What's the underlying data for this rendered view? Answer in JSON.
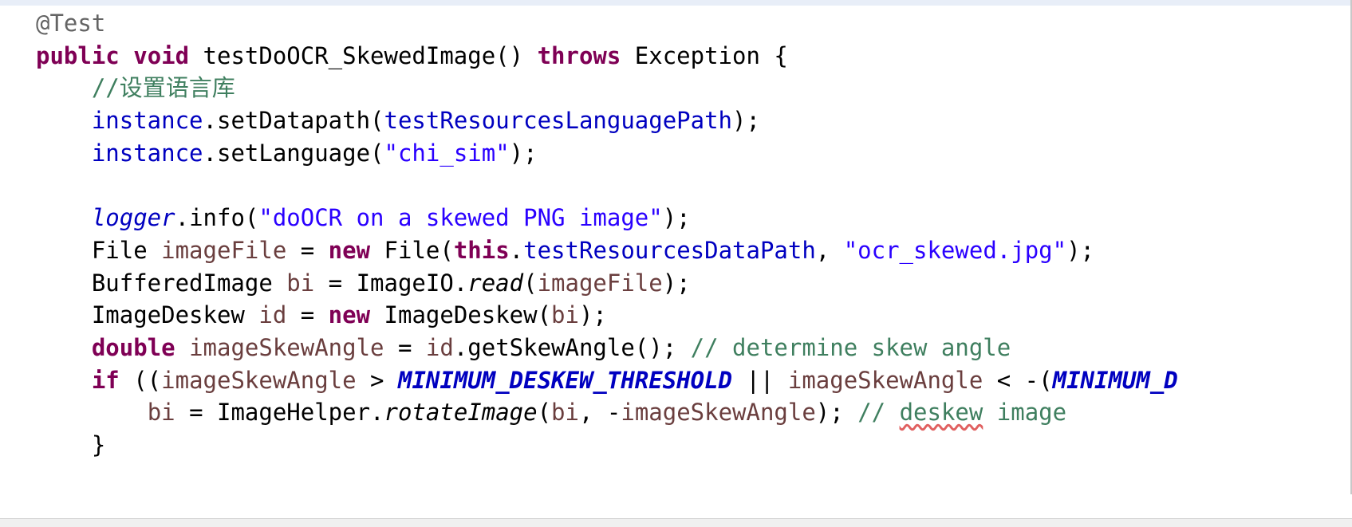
{
  "editor": {
    "lines": [
      {
        "tokens": [
          {
            "t": "@Test",
            "c": "annotation"
          }
        ]
      },
      {
        "tokens": [
          {
            "t": "public",
            "c": "kw"
          },
          {
            "t": " "
          },
          {
            "t": "void",
            "c": "kw"
          },
          {
            "t": " testDoOCR_SkewedImage() "
          },
          {
            "t": "throws",
            "c": "kw"
          },
          {
            "t": " Exception {"
          }
        ]
      },
      {
        "tokens": [
          {
            "t": "    "
          },
          {
            "t": "//设置语言库",
            "c": "cmt"
          }
        ]
      },
      {
        "tokens": [
          {
            "t": "    "
          },
          {
            "t": "instance",
            "c": "field"
          },
          {
            "t": ".setDatapath("
          },
          {
            "t": "testResourcesLanguagePath",
            "c": "field"
          },
          {
            "t": ");"
          }
        ]
      },
      {
        "tokens": [
          {
            "t": "    "
          },
          {
            "t": "instance",
            "c": "field"
          },
          {
            "t": ".setLanguage("
          },
          {
            "t": "\"chi_sim\"",
            "c": "str"
          },
          {
            "t": ");"
          }
        ]
      },
      {
        "tokens": []
      },
      {
        "tokens": [
          {
            "t": "    "
          },
          {
            "t": "logger",
            "c": "static-i"
          },
          {
            "t": ".info("
          },
          {
            "t": "\"doOCR on a skewed PNG image\"",
            "c": "str"
          },
          {
            "t": ");"
          }
        ]
      },
      {
        "tokens": [
          {
            "t": "    File "
          },
          {
            "t": "imageFile",
            "c": "local"
          },
          {
            "t": " = "
          },
          {
            "t": "new",
            "c": "kw"
          },
          {
            "t": " File("
          },
          {
            "t": "this",
            "c": "kw"
          },
          {
            "t": "."
          },
          {
            "t": "testResourcesDataPath",
            "c": "field"
          },
          {
            "t": ", "
          },
          {
            "t": "\"ocr_skewed.jpg\"",
            "c": "str"
          },
          {
            "t": ");"
          }
        ]
      },
      {
        "tokens": [
          {
            "t": "    BufferedImage "
          },
          {
            "t": "bi",
            "c": "local"
          },
          {
            "t": " = ImageIO."
          },
          {
            "t": "read",
            "c": "method-i"
          },
          {
            "t": "("
          },
          {
            "t": "imageFile",
            "c": "local"
          },
          {
            "t": ");"
          }
        ]
      },
      {
        "tokens": [
          {
            "t": "    ImageDeskew "
          },
          {
            "t": "id",
            "c": "local"
          },
          {
            "t": " = "
          },
          {
            "t": "new",
            "c": "kw"
          },
          {
            "t": " ImageDeskew("
          },
          {
            "t": "bi",
            "c": "local"
          },
          {
            "t": ");"
          }
        ]
      },
      {
        "tokens": [
          {
            "t": "    "
          },
          {
            "t": "double",
            "c": "kw"
          },
          {
            "t": " "
          },
          {
            "t": "imageSkewAngle",
            "c": "local"
          },
          {
            "t": " = "
          },
          {
            "t": "id",
            "c": "local"
          },
          {
            "t": ".getSkewAngle(); "
          },
          {
            "t": "// determine skew angle",
            "c": "cmt"
          }
        ]
      },
      {
        "tokens": [
          {
            "t": "    "
          },
          {
            "t": "if",
            "c": "kw"
          },
          {
            "t": " (("
          },
          {
            "t": "imageSkewAngle",
            "c": "local"
          },
          {
            "t": " > "
          },
          {
            "t": "MINIMUM_DESKEW_THRESHOLD",
            "c": "const"
          },
          {
            "t": " || "
          },
          {
            "t": "imageSkewAngle",
            "c": "local"
          },
          {
            "t": " < -("
          },
          {
            "t": "MINIMUM_D",
            "c": "const"
          }
        ]
      },
      {
        "tokens": [
          {
            "t": "        "
          },
          {
            "t": "bi",
            "c": "local"
          },
          {
            "t": " = ImageHelper."
          },
          {
            "t": "rotateImage",
            "c": "method-i"
          },
          {
            "t": "("
          },
          {
            "t": "bi",
            "c": "local"
          },
          {
            "t": ", -"
          },
          {
            "t": "imageSkewAngle",
            "c": "local"
          },
          {
            "t": "); "
          },
          {
            "t": "// ",
            "c": "cmt"
          },
          {
            "t": "deskew",
            "c": "cmt typo"
          },
          {
            "t": " image",
            "c": "cmt"
          }
        ]
      },
      {
        "tokens": [
          {
            "t": "    }"
          }
        ]
      }
    ]
  }
}
